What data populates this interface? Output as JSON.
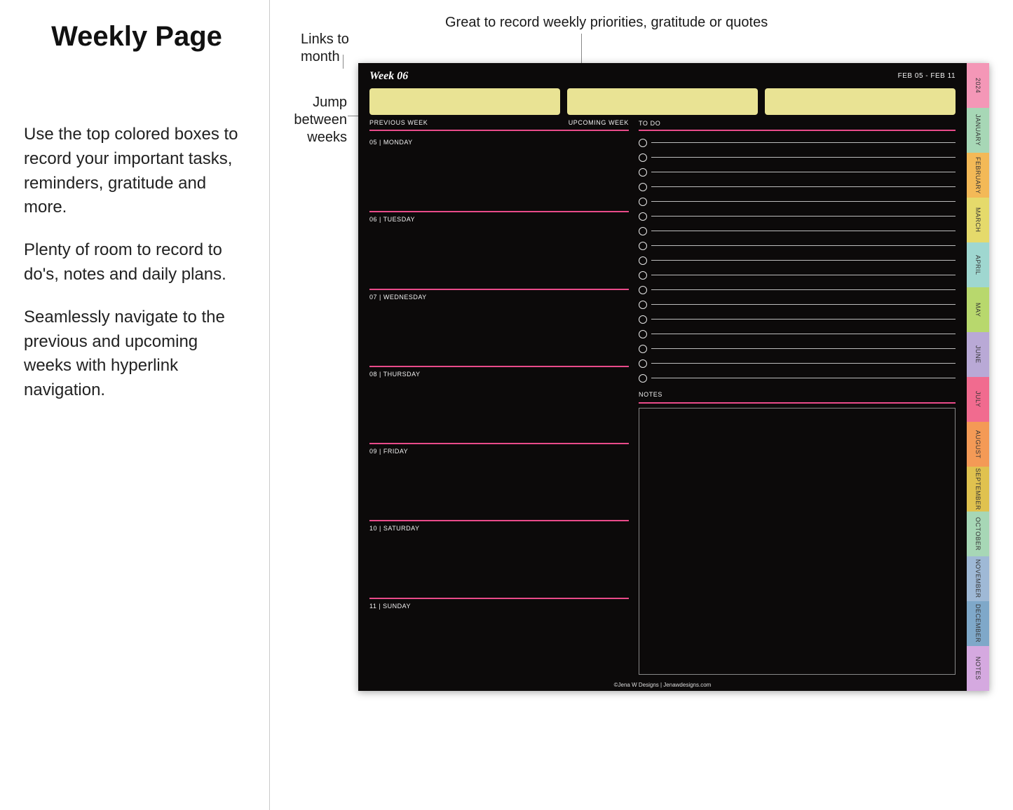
{
  "intro": {
    "title": "Weekly Page",
    "p1": "Use the top colored boxes to record your important tasks, reminders, gratitude and more.",
    "p2": "Plenty of room to record to do's, notes and daily plans.",
    "p3": "Seamlessly navigate to the previous and upcoming weeks with hyperlink navigation."
  },
  "annotations": {
    "month_link": "Links to month",
    "priorities": "Great to record weekly priorities, gratitude or quotes",
    "jump": "Jump between weeks"
  },
  "planner": {
    "week_title": "Week 06",
    "date_range": "FEB 05 - FEB 11",
    "nav_prev": "PREVIOUS WEEK",
    "nav_next": "UPCOMING WEEK",
    "todo_label": "TO DO",
    "notes_label": "NOTES",
    "footer": "©Jena W Designs | Jenawdesigns.com",
    "days": [
      "05 | MONDAY",
      "06 | TUESDAY",
      "07 | WEDNESDAY",
      "08 | THURSDAY",
      "09 | FRIDAY",
      "10 | SATURDAY",
      "11 | SUNDAY"
    ],
    "todo_count": 17,
    "tabs": [
      {
        "label": "2024",
        "color": "#f497b7"
      },
      {
        "label": "JANUARY",
        "color": "#a7d7b6"
      },
      {
        "label": "FEBRUARY",
        "color": "#f3b957"
      },
      {
        "label": "MARCH",
        "color": "#e5da6b"
      },
      {
        "label": "APRIL",
        "color": "#9fd7d0"
      },
      {
        "label": "MAY",
        "color": "#b8d86d"
      },
      {
        "label": "JUNE",
        "color": "#b9a9d6"
      },
      {
        "label": "JULY",
        "color": "#f16b8f"
      },
      {
        "label": "AUGUST",
        "color": "#f49a56"
      },
      {
        "label": "SEPTEMBER",
        "color": "#e0c24f"
      },
      {
        "label": "OCTOBER",
        "color": "#a7d7b6"
      },
      {
        "label": "NOVEMBER",
        "color": "#9fb9d6"
      },
      {
        "label": "DECEMBER",
        "color": "#7fa8c9"
      },
      {
        "label": "NOTES",
        "color": "#d5a9e0"
      }
    ]
  }
}
